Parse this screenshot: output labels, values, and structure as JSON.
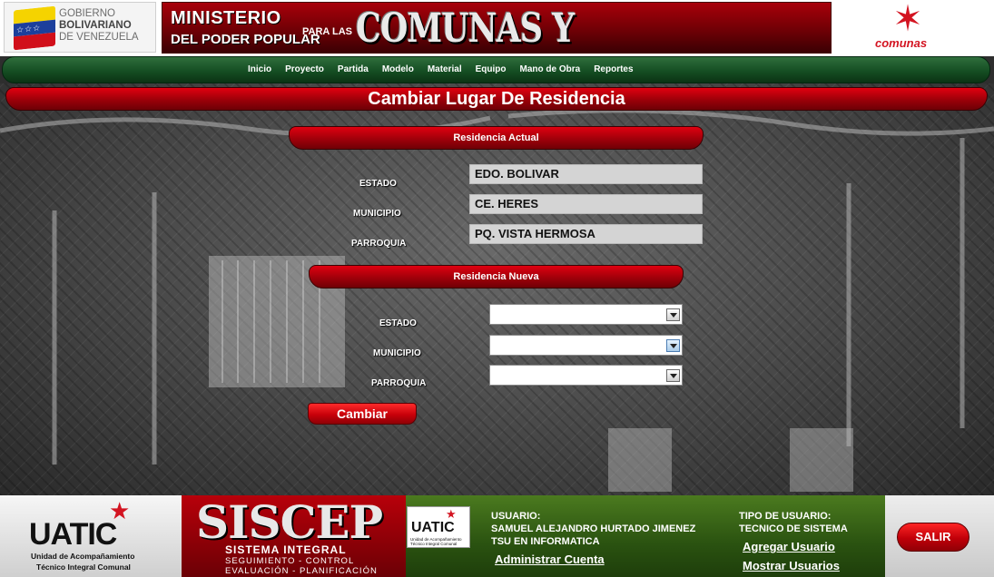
{
  "header": {
    "gob_line1": "GOBIERNO",
    "gob_line2": "BOLIVARIANO",
    "gob_line3": "DE VENEZUELA",
    "ministry_line1": "MINISTERIO",
    "ministry_line2": "DEL PODER POPULAR",
    "ministry_para": "PARA LAS",
    "ministry_big": "COMUNAS Y MOVIMIENTOS SOCIALES",
    "comunas_label": "comunas"
  },
  "nav": {
    "items": [
      "Inicio",
      "Proyecto",
      "Partida",
      "Modelo",
      "Material",
      "Equipo",
      "Mano de Obra",
      "Reportes"
    ]
  },
  "page": {
    "title": "Cambiar Lugar De Residencia"
  },
  "actual": {
    "section_title": "Residencia Actual",
    "estado_label": "ESTADO",
    "estado_value": "EDO. BOLIVAR",
    "municipio_label": "MUNICIPIO",
    "municipio_value": "CE. HERES",
    "parroquia_label": "PARROQUIA",
    "parroquia_value": "PQ. VISTA HERMOSA"
  },
  "nueva": {
    "section_title": "Residencia Nueva",
    "estado_label": "ESTADO",
    "estado_value": "",
    "municipio_label": "MUNICIPIO",
    "municipio_value": "",
    "parroquia_label": "PARROQUIA",
    "parroquia_value": ""
  },
  "submit_label": "Cambiar",
  "footer": {
    "uatic_big": "UATIC",
    "uatic_sub1": "Unidad de Acompañamiento",
    "uatic_sub2": "Técnico Integral Comunal",
    "siscep_big": "SISCEP",
    "siscep_sub1": "SISTEMA INTEGRAL",
    "siscep_sub2": "SEGUIMIENTO - CONTROL",
    "siscep_sub3": "EVALUACIÓN - PLANIFICACIÓN",
    "mini_logo": "UATIC",
    "mini_sub1": "Unidad de Acompañamiento",
    "mini_sub2": "Técnico Integral Comunal",
    "usuario_label": "USUARIO:",
    "usuario_name": "SAMUEL ALEJANDRO HURTADO JIMENEZ",
    "usuario_title": "TSU EN INFORMATICA",
    "tipo_label": "TIPO DE USUARIO:",
    "tipo_value": "TECNICO DE SISTEMA",
    "admin_link": "Administrar Cuenta",
    "add_link": "Agregar Usuario",
    "show_link": "Mostrar Usuarios",
    "logout": "SALIR"
  }
}
